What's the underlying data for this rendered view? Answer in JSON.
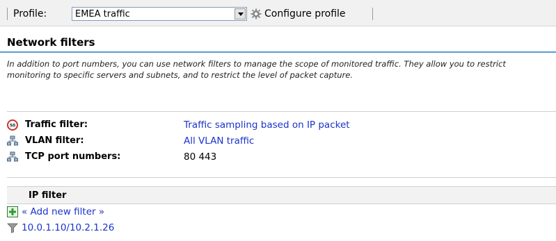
{
  "toolbar": {
    "profile_label": "Profile:",
    "profile_value": "EMEA traffic",
    "configure_label": "Configure profile"
  },
  "section": {
    "title": "Network filters",
    "description": "In addition to port numbers, you can use network filters to manage the scope of monitored traffic. They allow you to restrict monitoring to specific servers and subnets, and to restrict the level of packet capture."
  },
  "filters": [
    {
      "key": "Traffic filter:",
      "value": "Traffic sampling based on IP packet",
      "icon": "sampling-icon",
      "is_link": true
    },
    {
      "key": "VLAN filter:",
      "value": "All VLAN traffic",
      "icon": "network-icon",
      "is_link": true
    },
    {
      "key": "TCP port numbers:",
      "value": "80 443",
      "icon": "network-icon",
      "is_link": false
    }
  ],
  "ip_filter": {
    "header": "IP filter",
    "add_label": "« Add new filter »",
    "items": [
      "10.0.1.10/10.2.1.26"
    ]
  },
  "colors": {
    "link": "#1a33cc",
    "accent_line": "#5b9bd5",
    "sampling_icon": "#c0392b",
    "add_icon": "#2e9e2e"
  }
}
